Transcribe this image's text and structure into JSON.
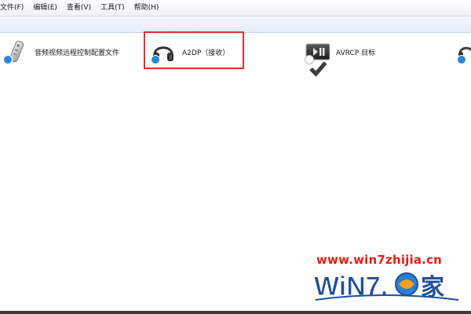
{
  "menu": [
    {
      "label": "文件(F)"
    },
    {
      "label": "编辑(E)"
    },
    {
      "label": "查看(V)"
    },
    {
      "label": "工具(T)"
    },
    {
      "label": "帮助(H)"
    }
  ],
  "devices": [
    {
      "label": "音频视频远程控制配置文件",
      "icon": "remote-control-icon"
    },
    {
      "label": "A2DP（接收）",
      "icon": "headphones-icon"
    },
    {
      "label": "AVRCP 目标",
      "icon": "media-player-icon"
    },
    {
      "label": "",
      "icon": "headset-icon"
    }
  ],
  "watermark": {
    "url": "www.win7zhijia.cn",
    "logo": "WiN7.之家"
  },
  "colors": {
    "highlight": "#e0302b",
    "watermark": "#e41e14",
    "check_badge": "#2a88d8"
  }
}
